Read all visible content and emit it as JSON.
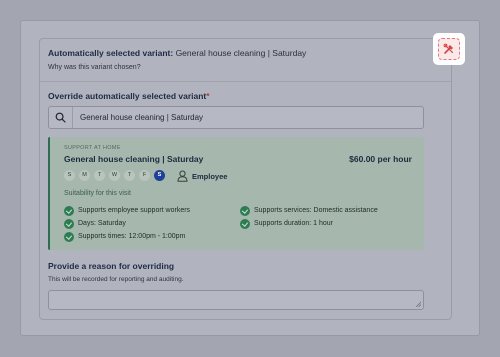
{
  "auto": {
    "label": "Automatically selected variant:",
    "value": "General house cleaning | Saturday",
    "why_link": "Why was this variant chosen?"
  },
  "override": {
    "label": "Override automatically selected variant",
    "required_mark": "*",
    "search_value": "General house cleaning | Saturday",
    "icon": "search-icon"
  },
  "variant": {
    "eyebrow": "SUPPORT AT HOME",
    "title": "General house cleaning | Saturday",
    "price": "$60.00 per hour",
    "days": [
      "S",
      "M",
      "T",
      "W",
      "T",
      "F",
      "S"
    ],
    "active_day_index": 6,
    "worker_type": "Employee",
    "suitability_heading": "Suitability for this visit",
    "criteria": [
      "Supports employee support workers",
      "Supports services: Domestic assistance",
      "Days: Saturday",
      "Supports duration: 1 hour",
      "Supports times: 12:00pm - 1:00pm"
    ],
    "colors": {
      "accent": "#2f6b4e",
      "active_day": "#203f97",
      "check": "#2e7d52"
    }
  },
  "reason": {
    "label": "Provide a reason for overriding",
    "help": "This will be recorded for reporting and auditing.",
    "value": ""
  },
  "tool_button": {
    "icon": "tools-icon"
  }
}
